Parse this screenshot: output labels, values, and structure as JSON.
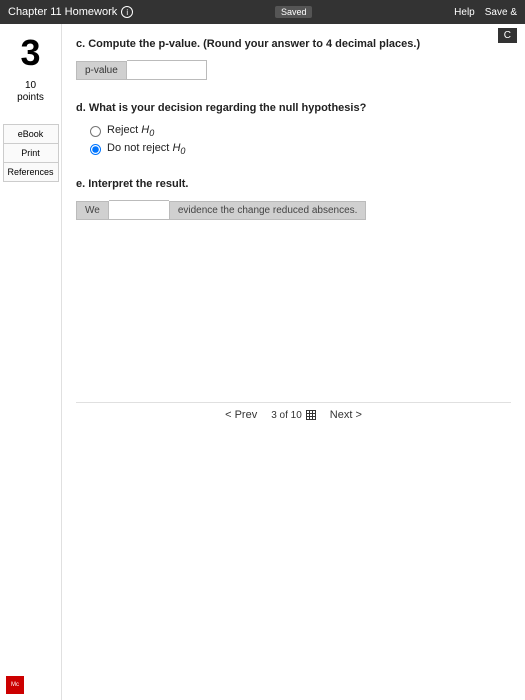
{
  "topbar": {
    "title": "Chapter 11 Homework",
    "saved": "Saved",
    "help": "Help",
    "save": "Save &",
    "check": "C"
  },
  "left": {
    "qnum": "3",
    "points_value": "10",
    "points_label": "points",
    "ebook": "eBook",
    "print": "Print",
    "references": "References"
  },
  "c": {
    "label": "c. Compute the p-value. (Round your answer to 4 decimal places.)",
    "field_label": "p-value",
    "value": ""
  },
  "d": {
    "label": "d. What is your decision regarding the null hypothesis?",
    "opt1": "Reject",
    "opt2": "Do not reject",
    "h0": "H",
    "h0_sub": "0"
  },
  "e": {
    "label": "e. Interpret the result.",
    "cell1": "We",
    "cell2": "evidence the change reduced absences."
  },
  "footer": {
    "prev": "Prev",
    "pos": "3 of 10",
    "next": "Next"
  },
  "logo": "Mc"
}
